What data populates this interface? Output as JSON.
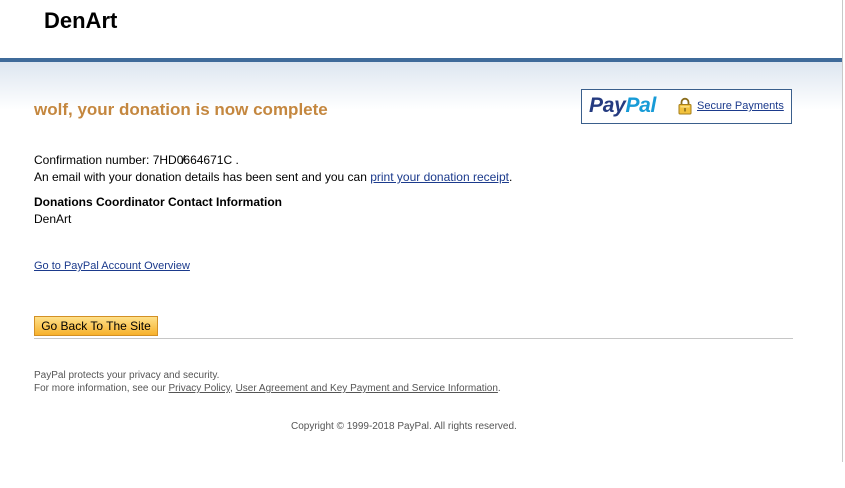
{
  "header": {
    "site_title": "DenArt"
  },
  "main": {
    "heading": "wolf, your donation is now complete",
    "confirmation_label": "Confirmation number: ",
    "confirmation_number": "7HD0̸664671C",
    "confirmation_end": " .",
    "email_text": "An email with your donation details has been sent and you can ",
    "receipt_link": "print your donation receipt",
    "email_end": ".",
    "contact_heading": "Donations Coordinator Contact Information",
    "contact_name": "DenArt",
    "overview_link": "Go to PayPal Account Overview",
    "back_button": "Go Back To The Site"
  },
  "badge": {
    "logo_pay": "Pay",
    "logo_pal": "Pal",
    "secure_link": "Secure Payments",
    "lock_icon": "padlock-icon"
  },
  "footer": {
    "privacy_text": "PayPal protects your privacy and security.",
    "more_info_text": "For more information, see our ",
    "privacy_policy_link": "Privacy Policy",
    "separator": ", ",
    "user_agreement_link": "User Agreement and Key Payment and Service Information",
    "period": ".",
    "copyright": "Copyright © 1999-2018 PayPal. All rights reserved."
  },
  "colors": {
    "heading": "#c4873f",
    "blue_bar": "#3f6b9a",
    "link": "#1b3a8c",
    "paypal_dark": "#253b80",
    "paypal_light": "#179bd7",
    "button_top": "#fee08a",
    "button_bottom": "#f7b12c"
  }
}
